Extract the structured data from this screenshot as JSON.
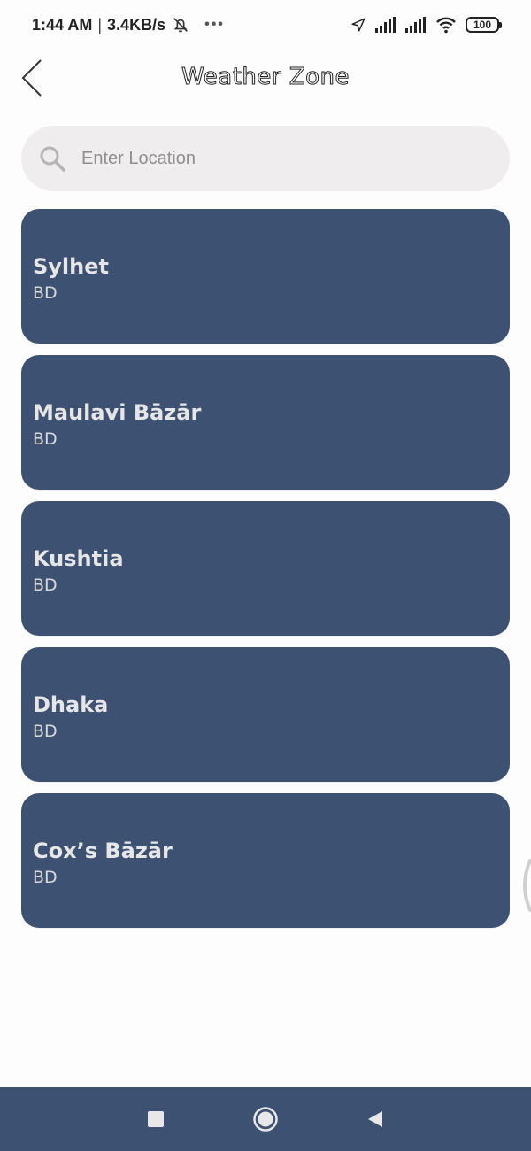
{
  "status_bar": {
    "time": "1:44 AM",
    "separator": "|",
    "speed": "3.4KB/s",
    "more": "•••",
    "battery": "100"
  },
  "header": {
    "title": "Weather Zone",
    "back_icon": "chevron-left-icon"
  },
  "search": {
    "placeholder": "Enter Location",
    "value": "",
    "icon": "search-icon"
  },
  "locations": [
    {
      "name": "Sylhet",
      "country": "BD"
    },
    {
      "name": "Maulavi Bāzār",
      "country": "BD"
    },
    {
      "name": "Kushtia",
      "country": "BD"
    },
    {
      "name": "Dhaka",
      "country": "BD"
    },
    {
      "name": "Cox’s Bāzār",
      "country": "BD"
    }
  ],
  "nav_bar": {
    "buttons": [
      "recents-square-icon",
      "home-circle-icon",
      "back-triangle-icon"
    ]
  },
  "colors": {
    "card": "#3d5172",
    "nav_bar": "#3d5172",
    "search_bg": "#efeded",
    "background": "#fdfdfd"
  }
}
